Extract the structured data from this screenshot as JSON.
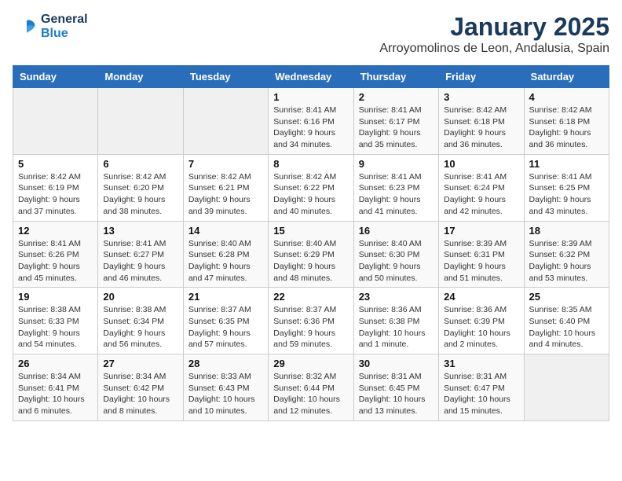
{
  "logo": {
    "line1": "General",
    "line2": "Blue"
  },
  "title": "January 2025",
  "subtitle": "Arroyomolinos de Leon, Andalusia, Spain",
  "days_of_week": [
    "Sunday",
    "Monday",
    "Tuesday",
    "Wednesday",
    "Thursday",
    "Friday",
    "Saturday"
  ],
  "weeks": [
    [
      {
        "day": "",
        "info": ""
      },
      {
        "day": "",
        "info": ""
      },
      {
        "day": "",
        "info": ""
      },
      {
        "day": "1",
        "info": "Sunrise: 8:41 AM\nSunset: 6:16 PM\nDaylight: 9 hours and 34 minutes."
      },
      {
        "day": "2",
        "info": "Sunrise: 8:41 AM\nSunset: 6:17 PM\nDaylight: 9 hours and 35 minutes."
      },
      {
        "day": "3",
        "info": "Sunrise: 8:42 AM\nSunset: 6:18 PM\nDaylight: 9 hours and 36 minutes."
      },
      {
        "day": "4",
        "info": "Sunrise: 8:42 AM\nSunset: 6:18 PM\nDaylight: 9 hours and 36 minutes."
      }
    ],
    [
      {
        "day": "5",
        "info": "Sunrise: 8:42 AM\nSunset: 6:19 PM\nDaylight: 9 hours and 37 minutes."
      },
      {
        "day": "6",
        "info": "Sunrise: 8:42 AM\nSunset: 6:20 PM\nDaylight: 9 hours and 38 minutes."
      },
      {
        "day": "7",
        "info": "Sunrise: 8:42 AM\nSunset: 6:21 PM\nDaylight: 9 hours and 39 minutes."
      },
      {
        "day": "8",
        "info": "Sunrise: 8:42 AM\nSunset: 6:22 PM\nDaylight: 9 hours and 40 minutes."
      },
      {
        "day": "9",
        "info": "Sunrise: 8:41 AM\nSunset: 6:23 PM\nDaylight: 9 hours and 41 minutes."
      },
      {
        "day": "10",
        "info": "Sunrise: 8:41 AM\nSunset: 6:24 PM\nDaylight: 9 hours and 42 minutes."
      },
      {
        "day": "11",
        "info": "Sunrise: 8:41 AM\nSunset: 6:25 PM\nDaylight: 9 hours and 43 minutes."
      }
    ],
    [
      {
        "day": "12",
        "info": "Sunrise: 8:41 AM\nSunset: 6:26 PM\nDaylight: 9 hours and 45 minutes."
      },
      {
        "day": "13",
        "info": "Sunrise: 8:41 AM\nSunset: 6:27 PM\nDaylight: 9 hours and 46 minutes."
      },
      {
        "day": "14",
        "info": "Sunrise: 8:40 AM\nSunset: 6:28 PM\nDaylight: 9 hours and 47 minutes."
      },
      {
        "day": "15",
        "info": "Sunrise: 8:40 AM\nSunset: 6:29 PM\nDaylight: 9 hours and 48 minutes."
      },
      {
        "day": "16",
        "info": "Sunrise: 8:40 AM\nSunset: 6:30 PM\nDaylight: 9 hours and 50 minutes."
      },
      {
        "day": "17",
        "info": "Sunrise: 8:39 AM\nSunset: 6:31 PM\nDaylight: 9 hours and 51 minutes."
      },
      {
        "day": "18",
        "info": "Sunrise: 8:39 AM\nSunset: 6:32 PM\nDaylight: 9 hours and 53 minutes."
      }
    ],
    [
      {
        "day": "19",
        "info": "Sunrise: 8:38 AM\nSunset: 6:33 PM\nDaylight: 9 hours and 54 minutes."
      },
      {
        "day": "20",
        "info": "Sunrise: 8:38 AM\nSunset: 6:34 PM\nDaylight: 9 hours and 56 minutes."
      },
      {
        "day": "21",
        "info": "Sunrise: 8:37 AM\nSunset: 6:35 PM\nDaylight: 9 hours and 57 minutes."
      },
      {
        "day": "22",
        "info": "Sunrise: 8:37 AM\nSunset: 6:36 PM\nDaylight: 9 hours and 59 minutes."
      },
      {
        "day": "23",
        "info": "Sunrise: 8:36 AM\nSunset: 6:38 PM\nDaylight: 10 hours and 1 minute."
      },
      {
        "day": "24",
        "info": "Sunrise: 8:36 AM\nSunset: 6:39 PM\nDaylight: 10 hours and 2 minutes."
      },
      {
        "day": "25",
        "info": "Sunrise: 8:35 AM\nSunset: 6:40 PM\nDaylight: 10 hours and 4 minutes."
      }
    ],
    [
      {
        "day": "26",
        "info": "Sunrise: 8:34 AM\nSunset: 6:41 PM\nDaylight: 10 hours and 6 minutes."
      },
      {
        "day": "27",
        "info": "Sunrise: 8:34 AM\nSunset: 6:42 PM\nDaylight: 10 hours and 8 minutes."
      },
      {
        "day": "28",
        "info": "Sunrise: 8:33 AM\nSunset: 6:43 PM\nDaylight: 10 hours and 10 minutes."
      },
      {
        "day": "29",
        "info": "Sunrise: 8:32 AM\nSunset: 6:44 PM\nDaylight: 10 hours and 12 minutes."
      },
      {
        "day": "30",
        "info": "Sunrise: 8:31 AM\nSunset: 6:45 PM\nDaylight: 10 hours and 13 minutes."
      },
      {
        "day": "31",
        "info": "Sunrise: 8:31 AM\nSunset: 6:47 PM\nDaylight: 10 hours and 15 minutes."
      },
      {
        "day": "",
        "info": ""
      }
    ]
  ]
}
